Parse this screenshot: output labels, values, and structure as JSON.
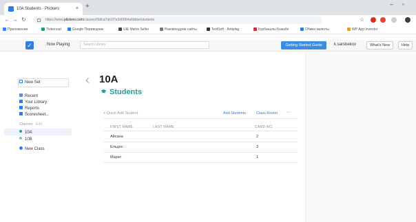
{
  "browser": {
    "tab_title": "10A Students - Plickers",
    "new_tab": "+",
    "close": "×",
    "url_prefix": "https://www.",
    "url_host": "plickers.com",
    "url_path": "/classes/5bfca7ab1f7e3d0004a6bbbe/students",
    "bookmarks": [
      "Приложения",
      "Tinkercad",
      "Google Переводчик",
      "UiE Matrix Seller",
      "Рекомендуем сайты",
      "TextSoft · Antiplag",
      "Курбаналы Кожабе",
      "Обмен валюты",
      "WP App Inventor"
    ],
    "bookmark_colors": [
      "#3b82f6",
      "#2a9a6a",
      "#2f7ee0",
      "#444444",
      "#777777",
      "#333333",
      "#cc3333",
      "#2f7ee0",
      "#e0a030"
    ]
  },
  "header": {
    "logo": "✓",
    "now_playing": "Now Playing",
    "search_placeholder": "Search Library",
    "getting_started": "Getting Started Guide",
    "user": "k.sarsbekov",
    "whats_new": "What's New",
    "help": "Help"
  },
  "sidebar": {
    "new_set": "New Set",
    "items": [
      "Recent",
      "Your Library",
      "Reports",
      "Scoresheet..."
    ],
    "classes_header": "Classes",
    "classes_edit": "Edit",
    "classes": [
      "10A",
      "10B"
    ],
    "new_class": "New Class"
  },
  "main": {
    "class_name": "10A",
    "section_title": "Students",
    "quick_add": "+ Quick Add Student",
    "add_students": "Add Students",
    "class_roster": "Class Roster",
    "more": "···",
    "columns": [
      "FIRST NAME",
      "LAST NAME",
      "CARD NO."
    ],
    "rows": [
      {
        "first": "Айсана",
        "last": "",
        "card": "2"
      },
      {
        "first": "Ельдос",
        "last": "",
        "card": "3"
      },
      {
        "first": "Марат",
        "last": "",
        "card": "1"
      }
    ]
  },
  "colors": {
    "accent": "#2f7ee0",
    "teal": "#2a9a9a"
  }
}
